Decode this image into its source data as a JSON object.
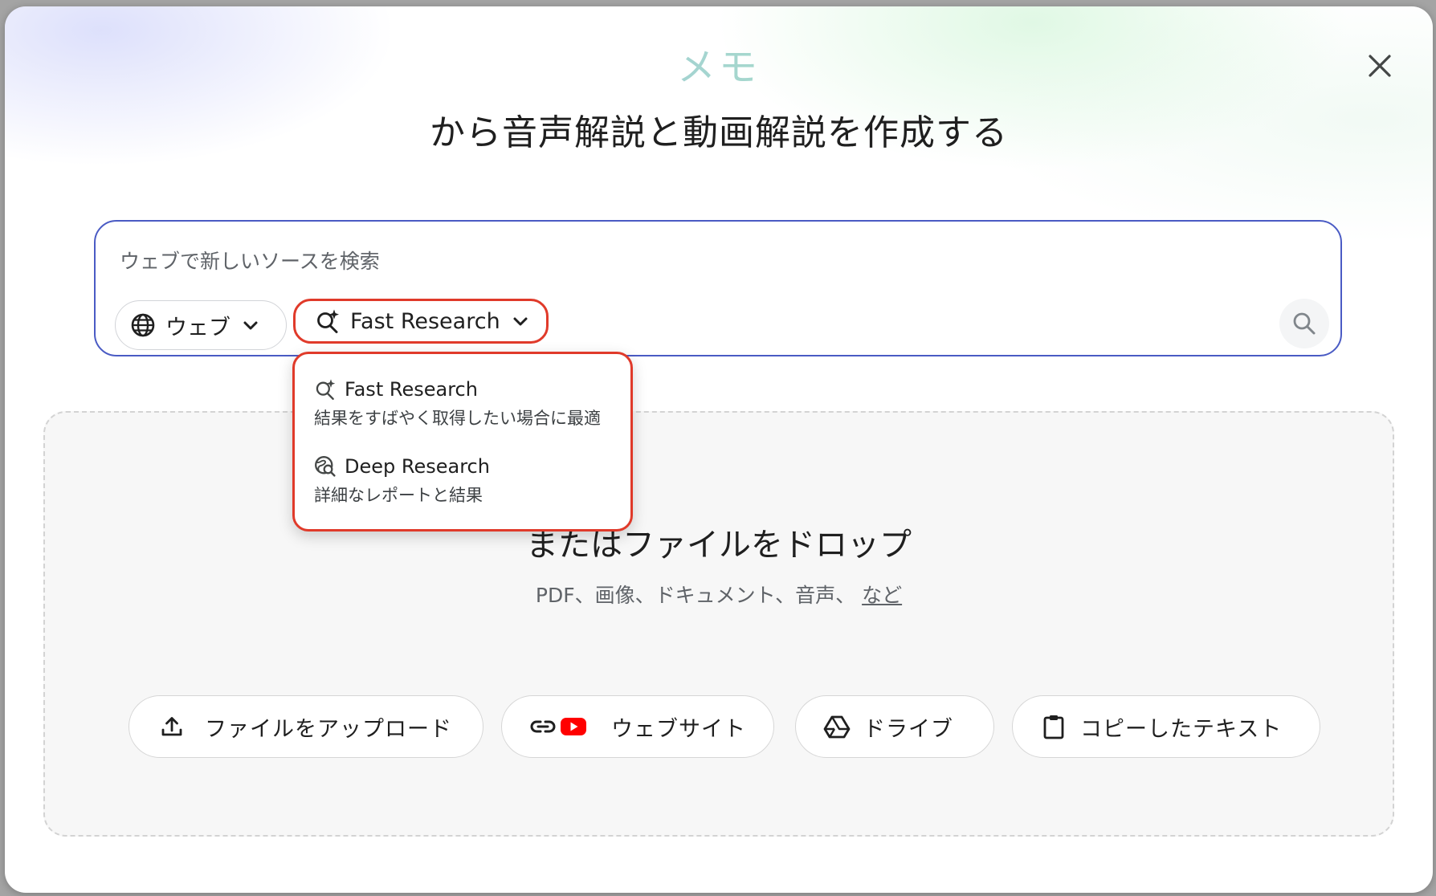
{
  "header": {
    "accent_title": "メモ",
    "title": "から音声解説と動画解説を作成する"
  },
  "search": {
    "placeholder": "ウェブで新しいソースを検索",
    "source_selector": {
      "label": "ウェブ",
      "icon": "globe-icon"
    },
    "mode_selector": {
      "label": "Fast Research",
      "icon": "sparkle-search-icon"
    },
    "submit_icon": "search-icon"
  },
  "mode_menu": {
    "items": [
      {
        "title": "Fast Research",
        "description": "結果をすばやく取得したい場合に最適",
        "icon": "sparkle-search-icon"
      },
      {
        "title": "Deep Research",
        "description": "詳細なレポートと結果",
        "icon": "deep-search-globe-icon"
      }
    ]
  },
  "drop_zone": {
    "title": "またはファイルをドロップ",
    "subtitle": "PDF、画像、ドキュメント、音声、",
    "more_link": "など"
  },
  "source_buttons": [
    {
      "label": "ファイルをアップロード",
      "icon": "upload-icon"
    },
    {
      "label": "ウェブサイト",
      "icon": "link-icon"
    },
    {
      "label": "ドライブ",
      "icon": "drive-icon"
    },
    {
      "label": "コピーしたテキスト",
      "icon": "clipboard-icon"
    }
  ],
  "colors": {
    "highlight_border": "#e03a2a",
    "search_border": "#4a5bc4",
    "youtube_red": "#ff0000"
  }
}
